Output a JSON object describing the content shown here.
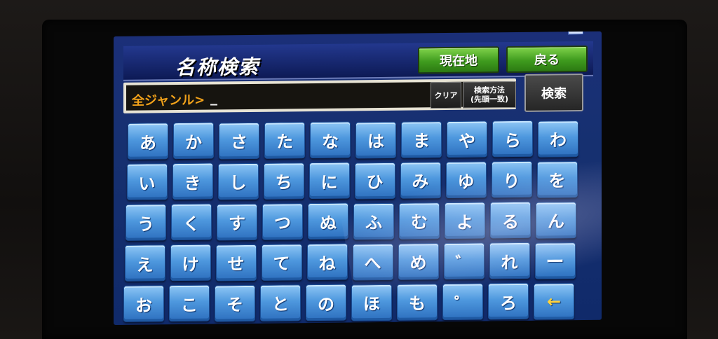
{
  "header": {
    "title": "名称検索",
    "current_location_label": "現在地",
    "back_label": "戻る"
  },
  "input": {
    "value": "全ジャンル>"
  },
  "controls": {
    "clear_label": "クリア",
    "method_line1": "検索方法",
    "method_line2": "(先頭一致)",
    "search_label": "検索"
  },
  "keyboard": {
    "rows": [
      [
        "あ",
        "か",
        "さ",
        "た",
        "な",
        "は",
        "ま",
        "や",
        "ら",
        "わ"
      ],
      [
        "い",
        "き",
        "し",
        "ち",
        "に",
        "ひ",
        "み",
        "ゆ",
        "り",
        "を"
      ],
      [
        "う",
        "く",
        "す",
        "つ",
        "ぬ",
        "ふ",
        "む",
        "よ",
        "る",
        "ん"
      ],
      [
        "え",
        "け",
        "せ",
        "て",
        "ね",
        "へ",
        "め",
        "゛",
        "れ",
        "ー"
      ],
      [
        "お",
        "こ",
        "そ",
        "と",
        "の",
        "ほ",
        "も",
        "゜",
        "ろ",
        "←"
      ]
    ]
  },
  "colors": {
    "screen": "#163070",
    "key": "#4e98de",
    "green_button": "#3f9b1e",
    "input_text": "#f2a21a"
  }
}
